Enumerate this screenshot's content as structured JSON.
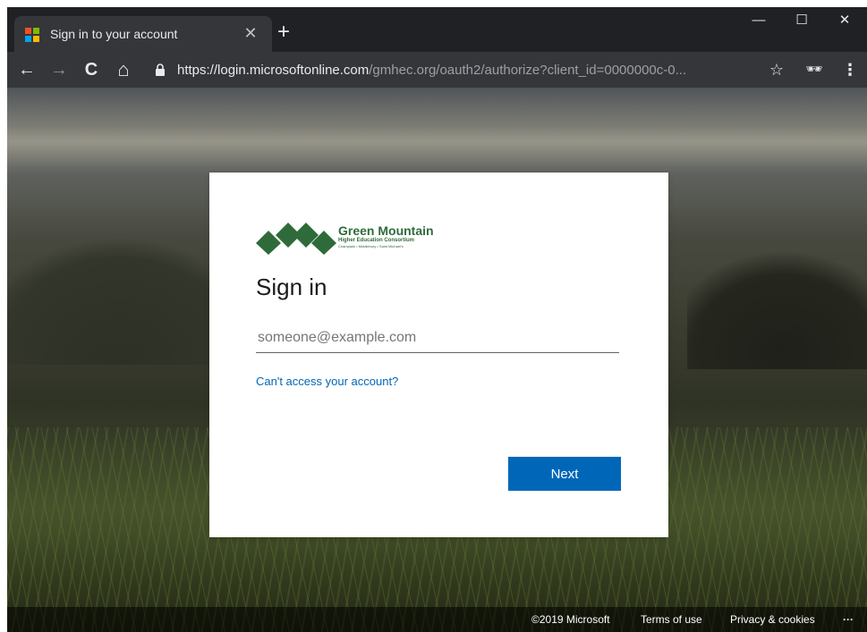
{
  "browser": {
    "tab": {
      "title": "Sign in to your account",
      "favicon_colors": [
        "#f25022",
        "#7fba00",
        "#00a4ef",
        "#ffb900"
      ],
      "close_glyph": "✕"
    },
    "new_tab_glyph": "+",
    "window_controls": {
      "minimize": "—",
      "maximize": "☐",
      "close": "✕"
    },
    "nav": {
      "back": "←",
      "forward": "→",
      "reload": "C",
      "home": "⌂"
    },
    "address": {
      "host_part": "https://login.microsoftonline.com",
      "path_part": "/gmhec.org/oauth2/authorize?client_id=0000000c-0..."
    },
    "bookmark_glyph": "☆",
    "incognito_glyph": "🕶",
    "menu_glyph": "⋮"
  },
  "signin": {
    "logo": {
      "name": "Green Mountain",
      "subtitle": "Higher Education Consortium",
      "members": "Champlain • Middlebury • Saint Michael's",
      "color": "#2f6b3a"
    },
    "heading": "Sign in",
    "email_placeholder": "someone@example.com",
    "email_value": "",
    "cant_access_link": "Can't access your account?",
    "next_button": "Next",
    "accent_color": "#0067b8"
  },
  "footer": {
    "copyright": "©2019 Microsoft",
    "terms": "Terms of use",
    "privacy": "Privacy & cookies",
    "more": "···"
  }
}
